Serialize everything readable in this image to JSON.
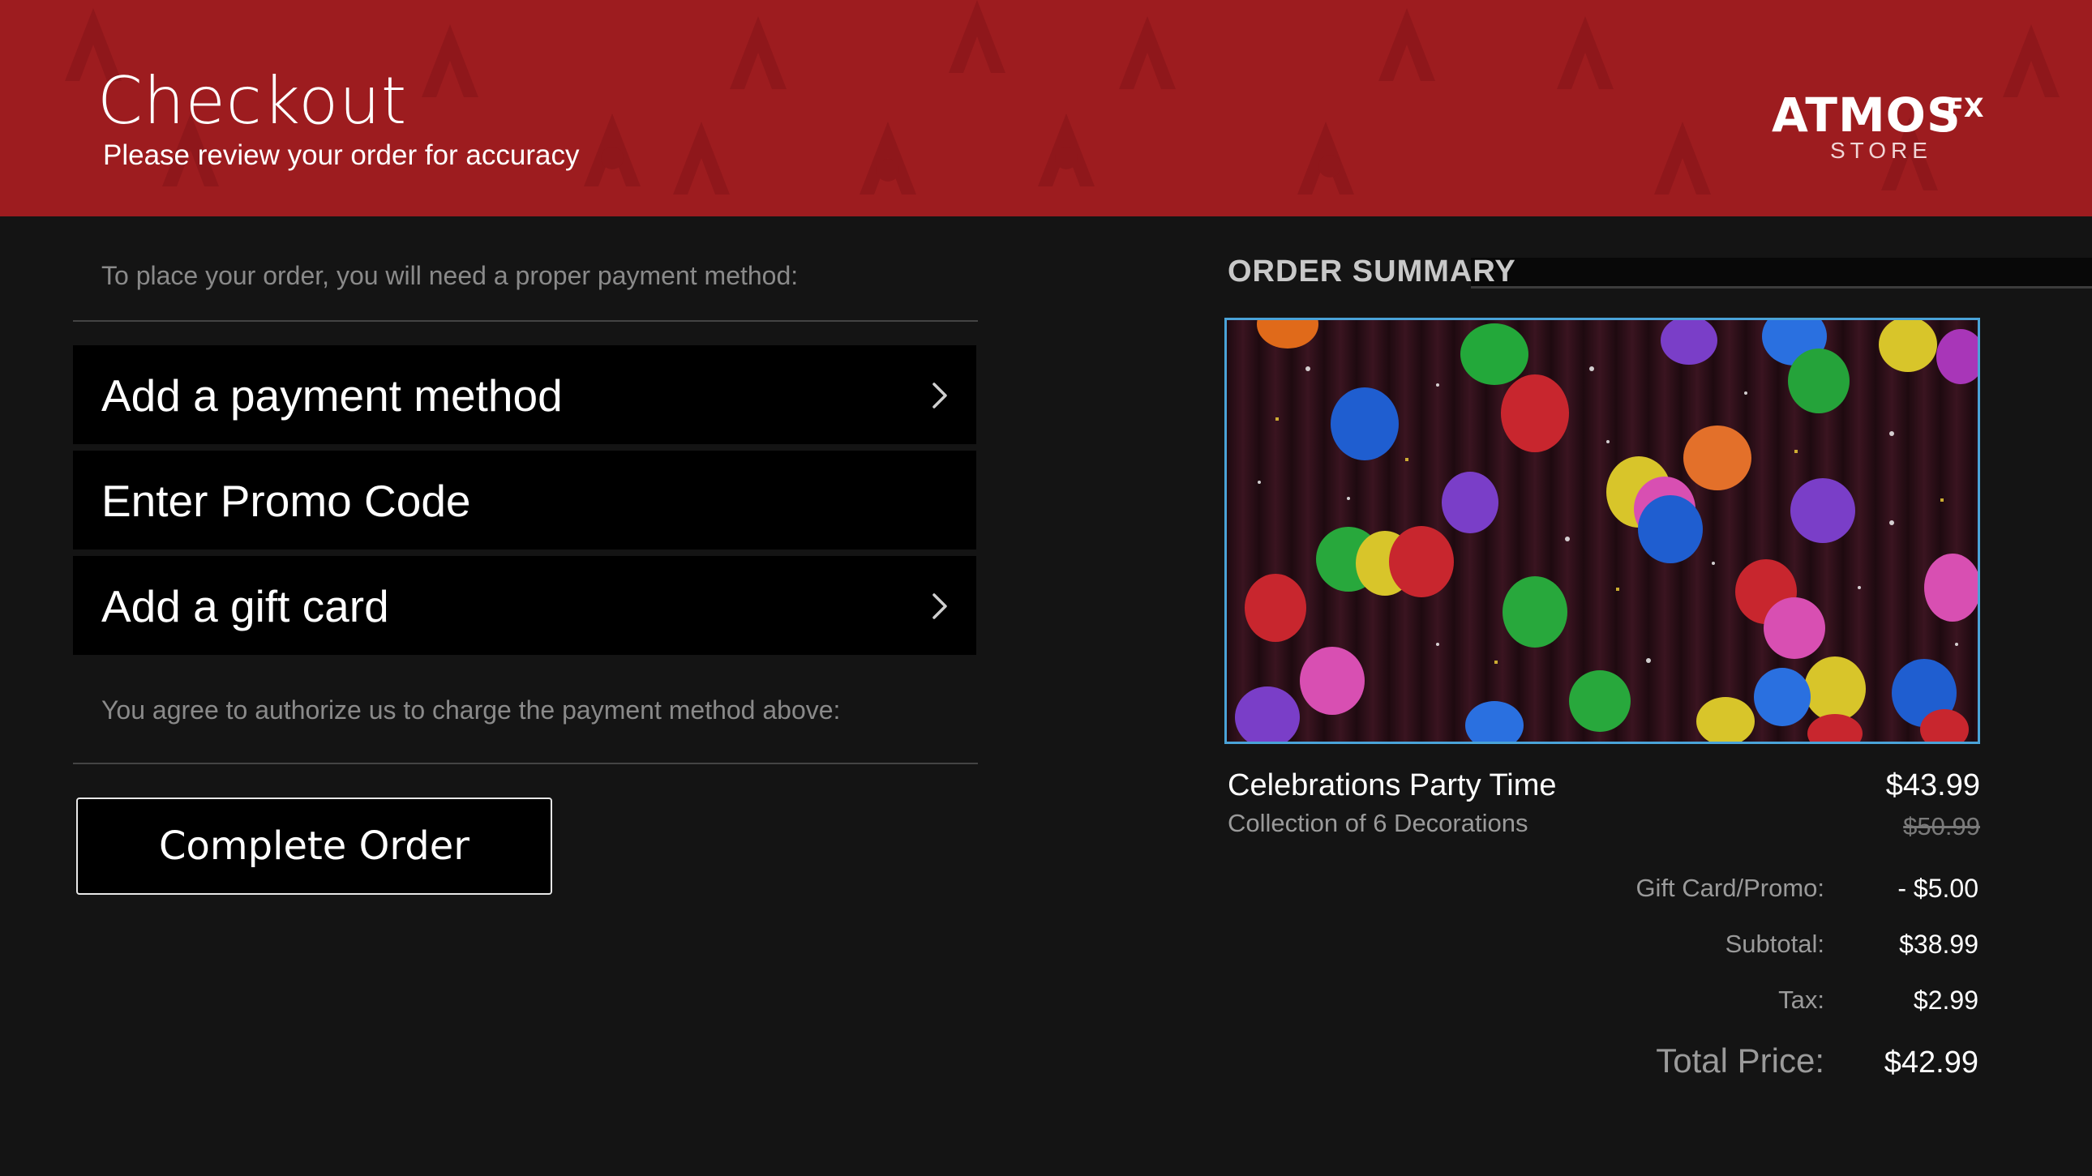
{
  "header": {
    "title": "Checkout",
    "subtitle": "Please review your order for accuracy",
    "brand_color": "#9d1c1f",
    "logo": {
      "main": "ATMOS",
      "fx": "FX",
      "store": "STORE"
    }
  },
  "left": {
    "payment_hint": "To place your order, you will need a proper payment method:",
    "options": [
      {
        "label": "Add a payment method",
        "icon": "chevron-right-icon"
      },
      {
        "label": "Enter Promo Code",
        "icon": ""
      },
      {
        "label": "Add a gift card",
        "icon": "chevron-right-icon"
      }
    ],
    "authorize_hint": "You agree to authorize us to charge the payment method above:",
    "complete_button": "Complete Order"
  },
  "summary": {
    "title": "ORDER SUMMARY",
    "product": {
      "name": "Celebrations Party Time",
      "description": "Collection of 6 Decorations",
      "price": "$43.99",
      "original_price": "$50.99"
    },
    "lines": [
      {
        "label": "Gift Card/Promo:",
        "value": "- $5.00"
      },
      {
        "label": "Subtotal:",
        "value": "$38.99"
      },
      {
        "label": "Tax:",
        "value": "$2.99"
      }
    ],
    "total_label": "Total Price:",
    "total_value": "$42.99",
    "accent_color": "#4aa3d8"
  }
}
